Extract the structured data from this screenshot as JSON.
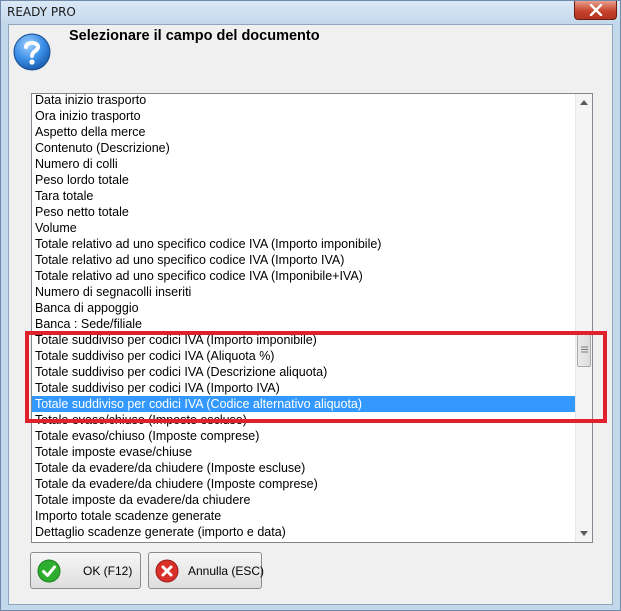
{
  "window": {
    "title": "READY PRO"
  },
  "dialog": {
    "prompt": "Selezionare il campo del documento"
  },
  "field_list": {
    "items": [
      "Data inizio trasporto",
      "Ora inizio trasporto",
      "Aspetto della merce",
      "Contenuto (Descrizione)",
      "Numero di colli",
      "Peso lordo totale",
      "Tara totale",
      "Peso netto totale",
      "Volume",
      "Totale relativo ad uno specifico codice IVA (Importo imponibile)",
      "Totale relativo ad uno specifico codice IVA (Importo IVA)",
      "Totale relativo ad uno specifico codice IVA (Imponibile+IVA)",
      "Numero di segnacolli inseriti",
      "Banca di appoggio",
      "Banca : Sede/filiale",
      "Totale suddiviso per codici IVA (Importo imponibile)",
      "Totale suddiviso per codici IVA (Aliquota %)",
      "Totale suddiviso per codici IVA (Descrizione aliquota)",
      "Totale suddiviso per codici IVA (Importo IVA)",
      "Totale suddiviso per codici IVA (Codice alternativo aliquota)",
      "Totale evaso/chiuso (Imposte escluse)",
      "Totale evaso/chiuso (Imposte comprese)",
      "Totale imposte evase/chiuse",
      "Totale da evadere/da chiudere (Imposte escluse)",
      "Totale da evadere/da chiudere (Imposte comprese)",
      "Totale imposte da evadere/da chiudere",
      "Importo totale scadenze generate",
      "Dettaglio scadenze generate (importo e data)"
    ],
    "selected_item": "Totale suddiviso per codici IVA (Codice alternativo aliquota)"
  },
  "buttons": {
    "ok_label": "OK (F12)",
    "cancel_label": "Annulla (ESC)"
  },
  "icons": {
    "question": "question-icon",
    "close": "close-icon",
    "ok": "check-icon",
    "cancel": "cancel-icon"
  },
  "colors": {
    "selection": "#3399ff",
    "highlight_frame": "#e0202a",
    "ok_green": "#2eae2e",
    "cancel_red": "#d9302a"
  }
}
